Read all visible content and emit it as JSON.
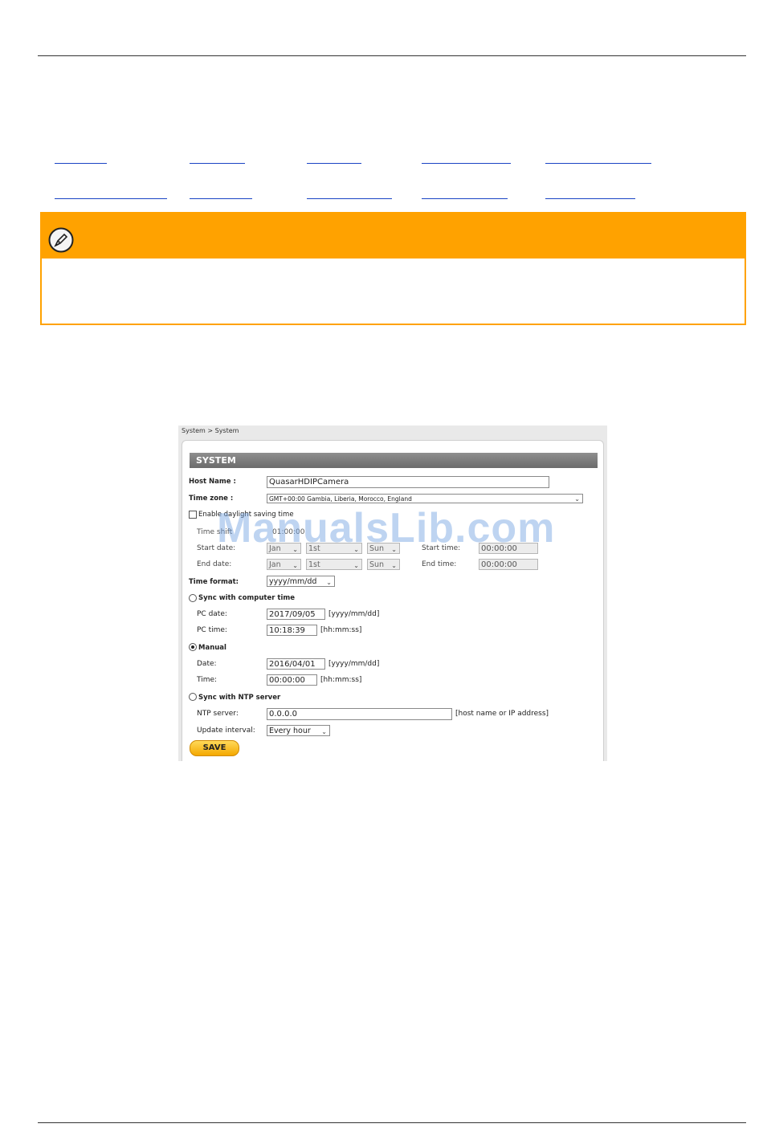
{
  "links_row1_count": 5,
  "links_row2_count": 5,
  "screenshot": {
    "breadcrumb": "System > System",
    "title": "SYSTEM",
    "host_name_label": "Host Name :",
    "host_name_value": "QuasarHDIPCamera",
    "time_zone_label": "Time zone :",
    "time_zone_value": "GMT+00:00 Gambia, Liberia, Morocco, England",
    "dst_label": "Enable daylight saving time",
    "time_shift_label": "Time shift",
    "time_shift_value": "01:00:00",
    "start_date_label": "Start date:",
    "end_date_label": "End date:",
    "start_month": "Jan",
    "start_day": "1st",
    "start_weekday": "Sun",
    "end_month": "Jan",
    "end_day": "1st",
    "end_weekday": "Sun",
    "start_time_label": "Start time:",
    "start_time_value": "00:00:00",
    "end_time_label": "End time:",
    "end_time_value": "00:00:00",
    "time_format_label": "Time format:",
    "time_format_value": "yyyy/mm/dd",
    "sync_pc_label": "Sync with computer time",
    "pc_date_label": "PC date:",
    "pc_date_value": "2017/09/05",
    "pc_date_hint": "[yyyy/mm/dd]",
    "pc_time_label": "PC time:",
    "pc_time_value": "10:18:39",
    "pc_time_hint": "[hh:mm:ss]",
    "manual_label": "Manual",
    "date_label": "Date:",
    "date_value": "2016/04/01",
    "date_hint": "[yyyy/mm/dd]",
    "time_label": "Time:",
    "time_value": "00:00:00",
    "time_hint": "[hh:mm:ss]",
    "ntp_sync_label": "Sync with NTP server",
    "ntp_server_label": "NTP server:",
    "ntp_server_value": "0.0.0.0",
    "ntp_server_hint": "[host name or IP address]",
    "update_interval_label": "Update interval:",
    "update_interval_value": "Every hour",
    "save_label": "SAVE"
  },
  "watermark": "ManualsLib.com",
  "colors": {
    "note_accent": "#ffa200",
    "link": "#1a44c4"
  }
}
